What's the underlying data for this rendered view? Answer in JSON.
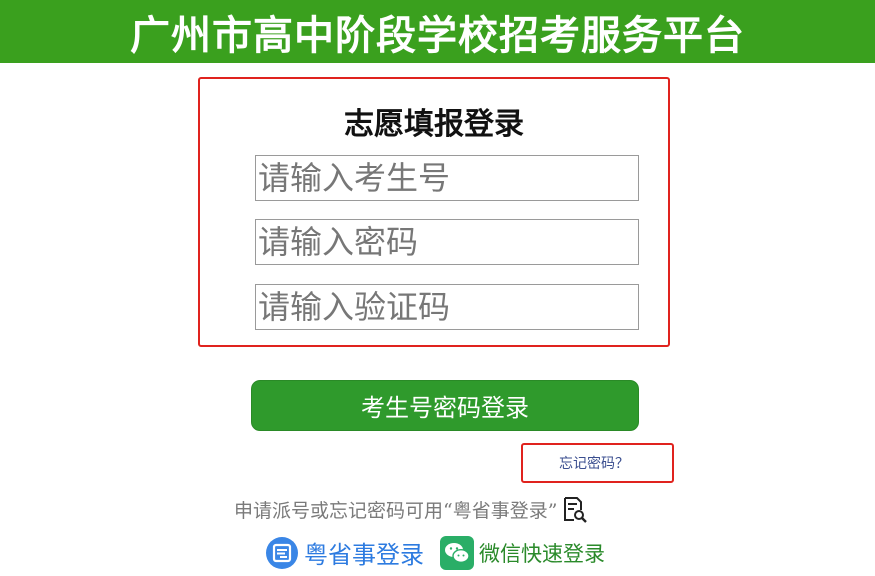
{
  "header": {
    "title": "广州市高中阶段学校招考服务平台"
  },
  "login": {
    "title": "志愿填报登录",
    "student_id_placeholder": "请输入考生号",
    "password_placeholder": "请输入密码",
    "captcha_placeholder": "请输入验证码"
  },
  "actions": {
    "login_button": "考生号密码登录",
    "forgot_password": "忘记密码？"
  },
  "hint": {
    "text": "申请派号或忘记密码可用“粤省事登录”",
    "icon": "document-search-icon"
  },
  "alt_logins": {
    "yueshengshi": {
      "label": "粤省事登录",
      "icon": "yueshengshi-logo-icon",
      "color": "#2d7be0"
    },
    "wechat": {
      "label": "微信快速登录",
      "icon": "wechat-icon",
      "color": "#2aae67"
    }
  },
  "colors": {
    "header_bg": "#3aa01e",
    "button_bg": "#2f9a2c",
    "highlight_border": "#e0231e"
  }
}
